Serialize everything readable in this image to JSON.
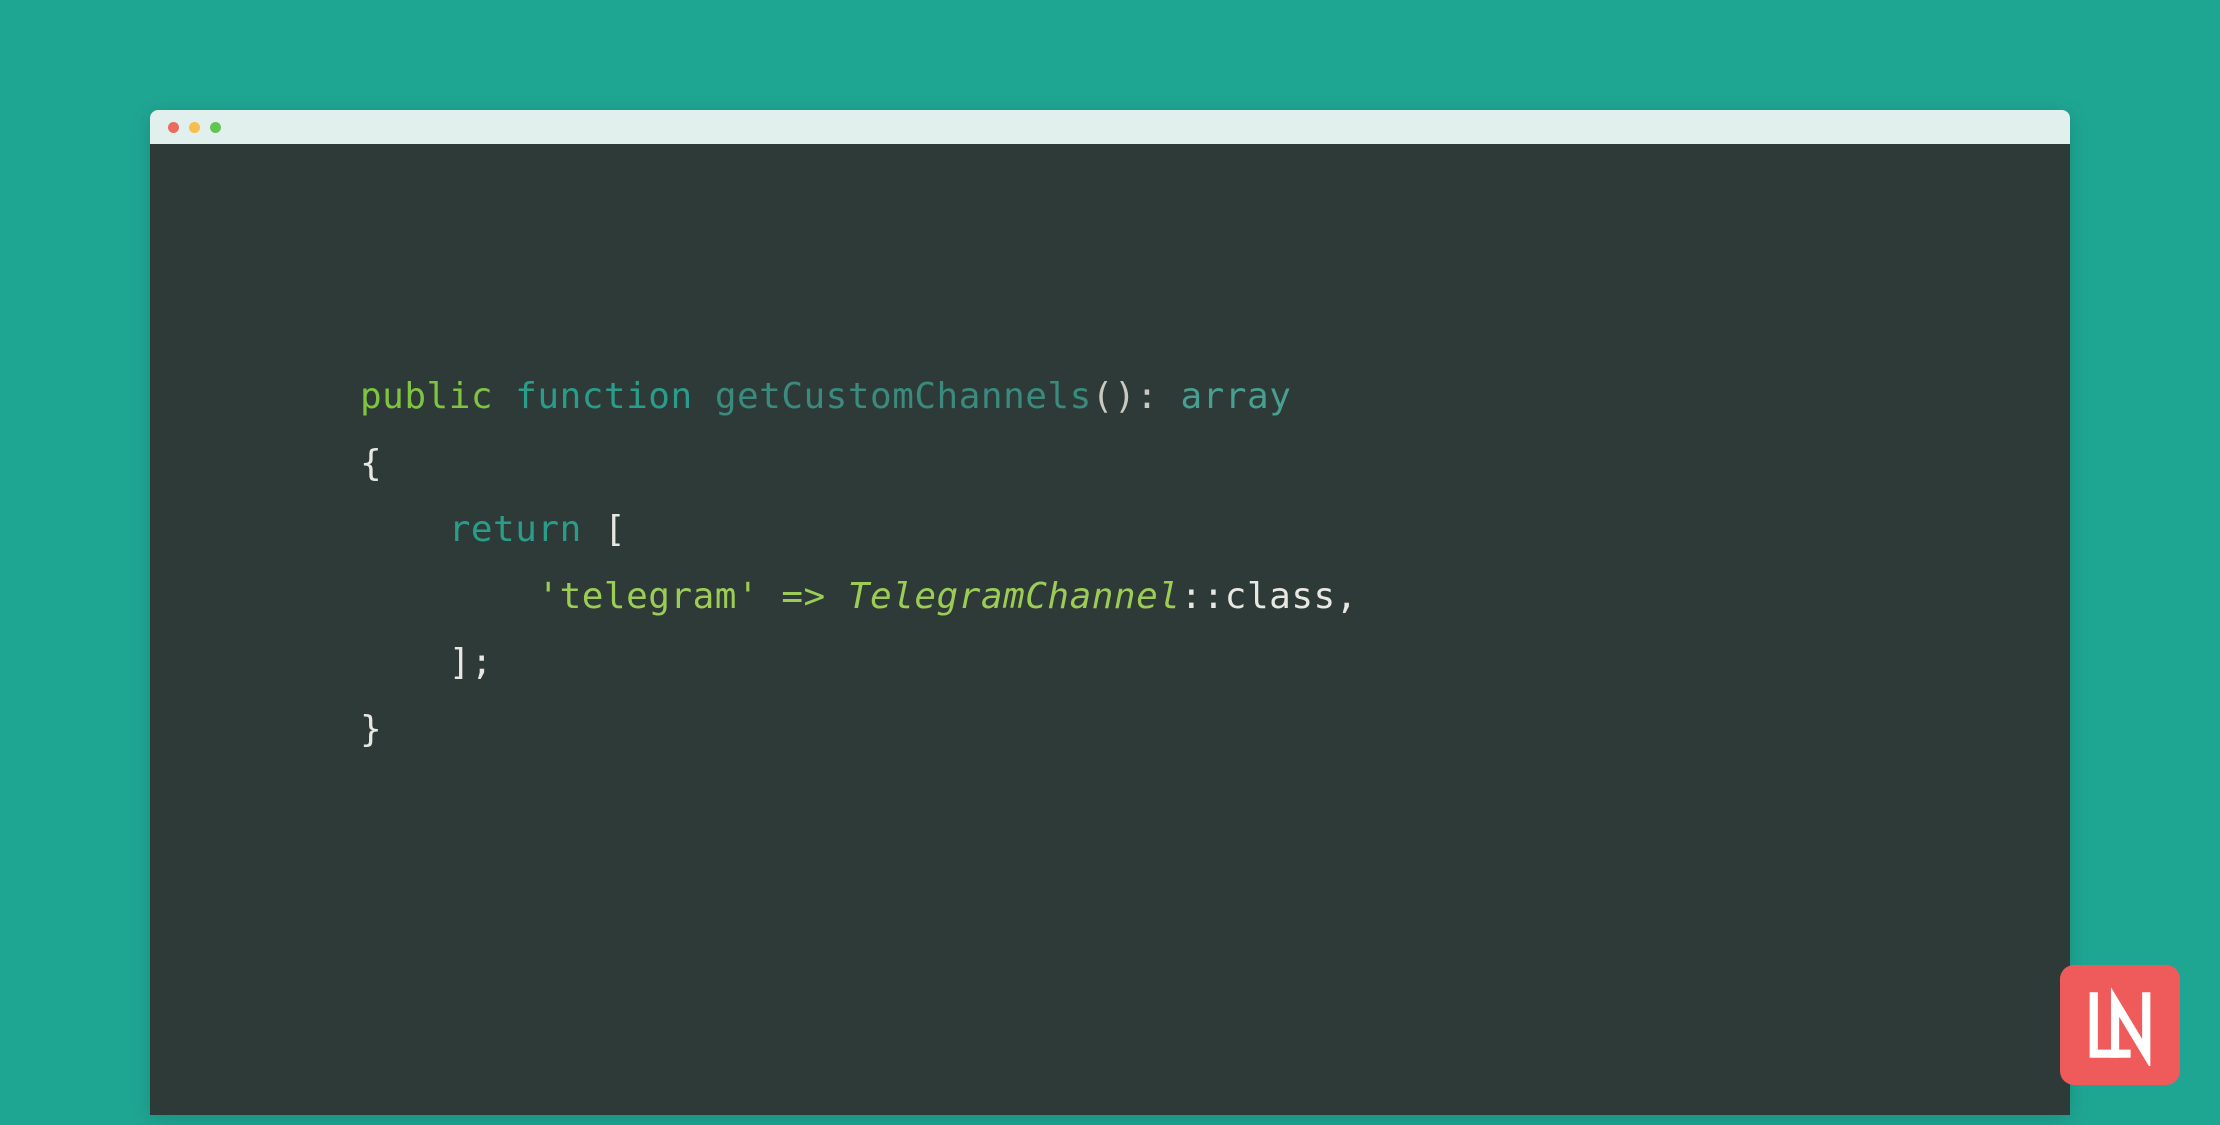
{
  "code": {
    "line1": {
      "public": "public",
      "function": "function",
      "name": "getCustomChannels",
      "parens": "()",
      "colon": ": ",
      "type": "array"
    },
    "line2": {
      "brace": "{"
    },
    "line3": {
      "indent": "    ",
      "return": "return",
      "space": " ",
      "bracket": "["
    },
    "line4": {
      "indent": "        ",
      "string": "'telegram'",
      "arrow": " => ",
      "classname": "TelegramChannel",
      "static": "::class,"
    },
    "line5": {
      "indent": "    ",
      "bracket": "];"
    },
    "line6": {
      "brace": "}"
    }
  },
  "logo": {
    "text": "LN"
  }
}
